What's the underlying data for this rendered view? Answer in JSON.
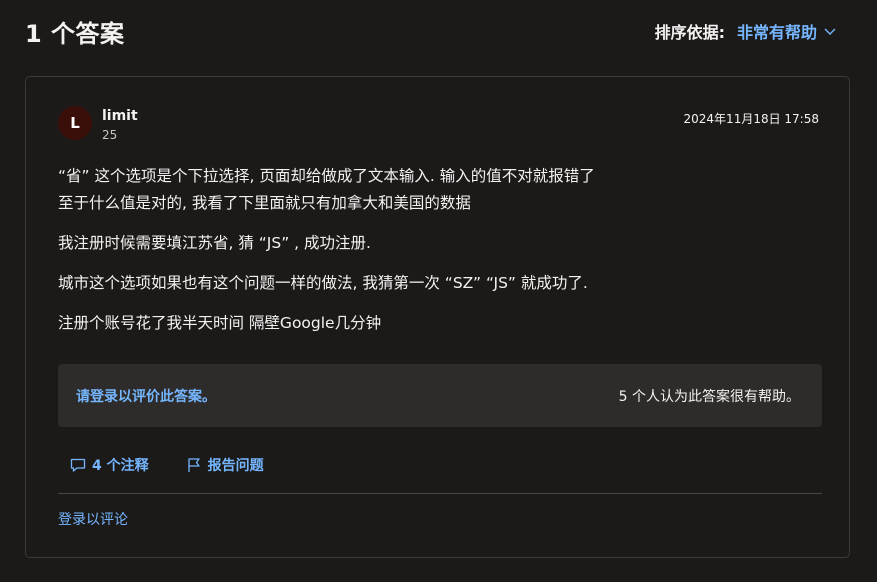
{
  "header": {
    "answers_count": "1 个答案",
    "sort_label": "排序依据:",
    "sort_value": "非常有帮助"
  },
  "answer": {
    "avatar_letter": "L",
    "author_name": "limit",
    "author_reputation": "25",
    "timestamp": "2024年11月18日 17:58",
    "paragraphs": [
      [
        "“省” 这个选项是个下拉选择, 页面却给做成了文本输入. 输入的值不对就报错了",
        "至于什么值是对的, 我看了下里面就只有加拿大和美国的数据"
      ],
      [
        "我注册时候需要填江苏省, 猜 “JS” , 成功注册."
      ],
      [
        "城市这个选项如果也有这个问题一样的做法, 我猜第一次 “SZ” “JS” 就成功了."
      ],
      [
        "注册个账号花了我半天时间 隔壁Google几分钟"
      ]
    ],
    "rate_prompt": "请登录以评价此答案。",
    "helpful_count": "5 个人认为此答案很有帮助。",
    "comments_label": "4 个注释",
    "report_label": "报告问题",
    "login_to_comment": "登录以评论"
  },
  "colors": {
    "background": "#1b1a19",
    "accent_link": "#75b6ff",
    "rate_box": "#2d2c2b",
    "avatar_bg": "#3a0f0a"
  },
  "icons": {
    "sort_chevron": "chevron-down-icon",
    "comments": "comment-icon",
    "report": "flag-icon"
  }
}
